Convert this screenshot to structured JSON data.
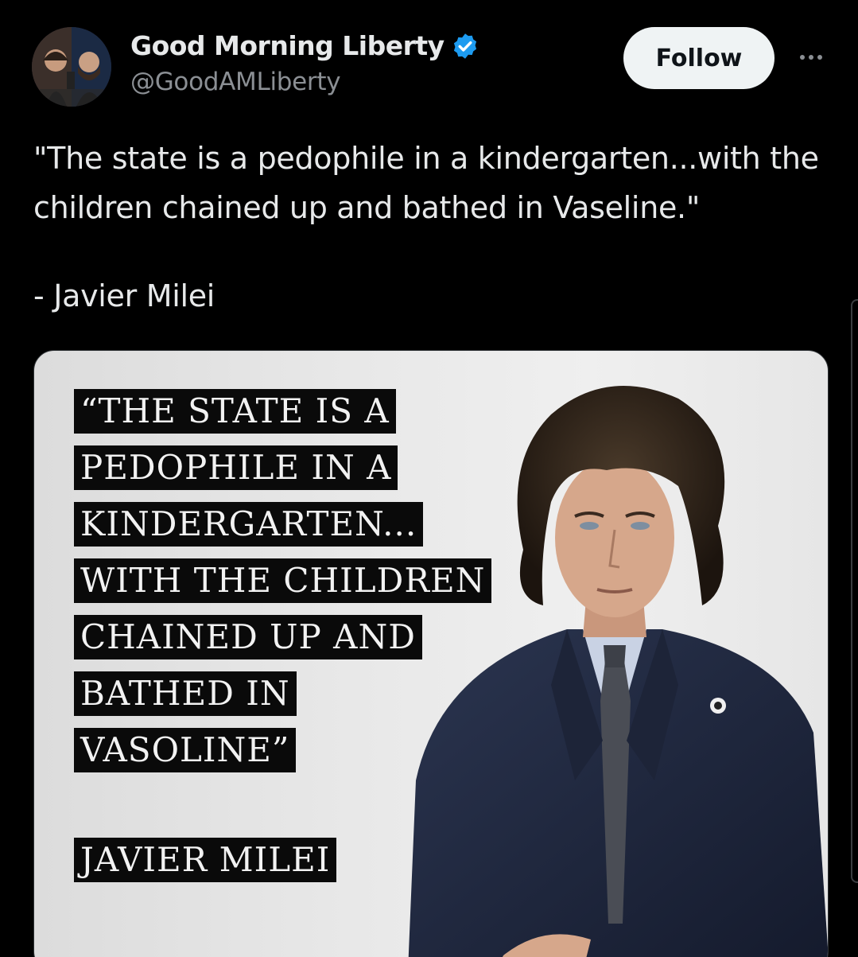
{
  "post": {
    "author": {
      "display_name": "Good Morning Liberty",
      "handle": "@GoodAMLiberty",
      "verified": true,
      "avatar_icon": "podcast-hosts-avatar"
    },
    "follow_label": "Follow",
    "more_icon": "more-options-icon",
    "text_lines": [
      "\"The state is a pedophile in a kindergarten...with the",
      "children chained up and bathed in Vaseline.\""
    ],
    "attribution": "- Javier Milei"
  },
  "media": {
    "quote_lines": [
      "“THE STATE IS A",
      "PEDOPHILE IN A",
      "KINDERGARTEN...",
      "WITH THE CHILDREN",
      "CHAINED UP AND",
      "BATHED IN",
      "VASOLINE”"
    ],
    "quote_author": "JAVIER MILEI",
    "portrait_icon": "man-in-suit-portrait"
  },
  "colors": {
    "background": "#000000",
    "text_primary": "#e7e9ea",
    "text_secondary": "#8b8f94",
    "verified_blue": "#1d9bf0",
    "follow_bg": "#eff3f4"
  }
}
